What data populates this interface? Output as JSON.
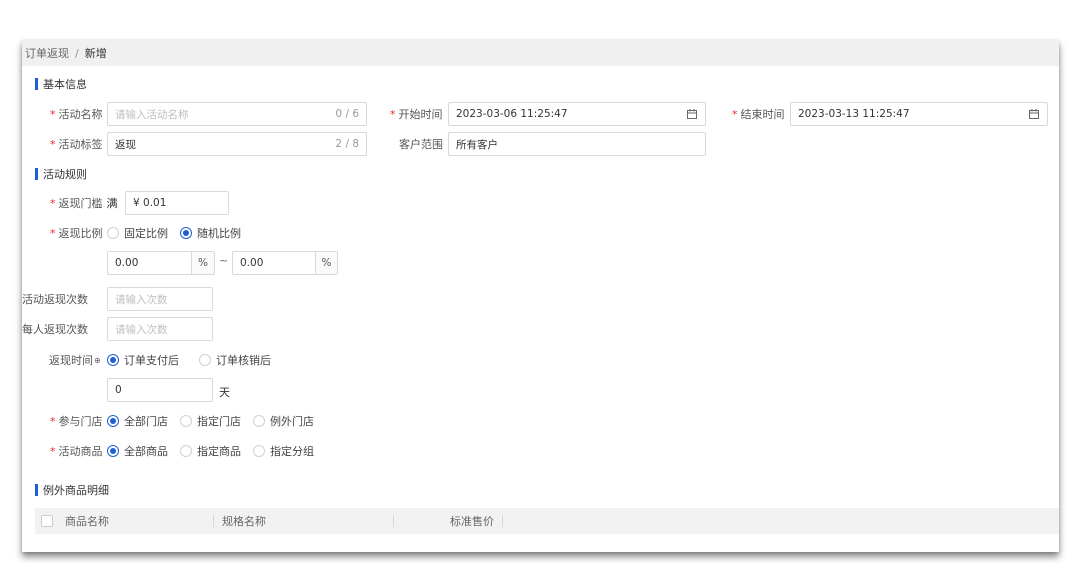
{
  "breadcrumb": {
    "parent": "订单返现",
    "separator": "/",
    "current": "新增"
  },
  "sections": {
    "basic": "基本信息",
    "rules": "活动规则",
    "exceptions": "例外商品明细"
  },
  "basic": {
    "activity_name": {
      "label": "活动名称",
      "placeholder": "请输入活动名称",
      "count": "0 / 6"
    },
    "start_time": {
      "label": "开始时间",
      "value": "2023-03-06 11:25:47"
    },
    "end_time": {
      "label": "结束时间",
      "value": "2023-03-13 11:25:47"
    },
    "activity_tag": {
      "label": "活动标签",
      "value": "返现",
      "count": "2 / 8"
    },
    "customer_scope": {
      "label": "客户范围",
      "value": "所有客户"
    }
  },
  "rules": {
    "threshold": {
      "label": "返现门槛",
      "prefix": "满",
      "value": "¥ 0.01"
    },
    "ratio": {
      "label": "返现比例",
      "options": [
        "固定比例",
        "随机比例"
      ],
      "selected": 1,
      "min": "0.00",
      "max": "0.00",
      "unit": "%",
      "tilde": "~"
    },
    "activity_times": {
      "label": "活动返现次数",
      "placeholder": "请输入次数"
    },
    "per_person_times": {
      "label": "每人返现次数",
      "placeholder": "请输入次数"
    },
    "cashback_time": {
      "label": "返现时间",
      "info": "⊕",
      "options": [
        "订单支付后",
        "订单核销后"
      ],
      "selected": 0,
      "days_value": "0",
      "days_unit": "天"
    },
    "stores": {
      "label": "参与门店",
      "options": [
        "全部门店",
        "指定门店",
        "例外门店"
      ],
      "selected": 0
    },
    "goods": {
      "label": "活动商品",
      "options": [
        "全部商品",
        "指定商品",
        "指定分组"
      ],
      "selected": 0
    }
  },
  "table": {
    "columns": [
      "商品名称",
      "规格名称",
      "标准售价"
    ]
  },
  "colors": {
    "accent": "#1f5fd6",
    "required": "#f5222d"
  }
}
